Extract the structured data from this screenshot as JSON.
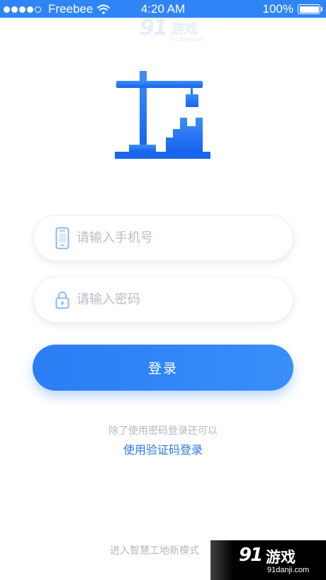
{
  "status_bar": {
    "carrier": "Freebee",
    "time": "4:20 AM",
    "battery": "100%",
    "battery_level": 1.0,
    "signal_bars": 4,
    "signal_max": 5
  },
  "watermark_top": {
    "number": "91",
    "text": "游戏",
    "url": "91danji.com"
  },
  "login": {
    "phone_placeholder": "请输入手机号",
    "password_placeholder": "请输入密码",
    "phone_icon": "phone-icon",
    "lock_icon": "lock-icon",
    "submit_label": "登录",
    "alt_hint": "除了使用密码登录还可以",
    "alt_link": "使用验证码登录",
    "enter_mode": "进入智慧工地新模式"
  },
  "watermark_bottom": {
    "number": "91",
    "text": "游戏",
    "url": "91danji.com"
  },
  "colors": {
    "accent": "#2a7df4",
    "status_bar": "#2f85f6",
    "icon_tint": "#8ab8f3",
    "hint_text": "#b3b7bd"
  }
}
